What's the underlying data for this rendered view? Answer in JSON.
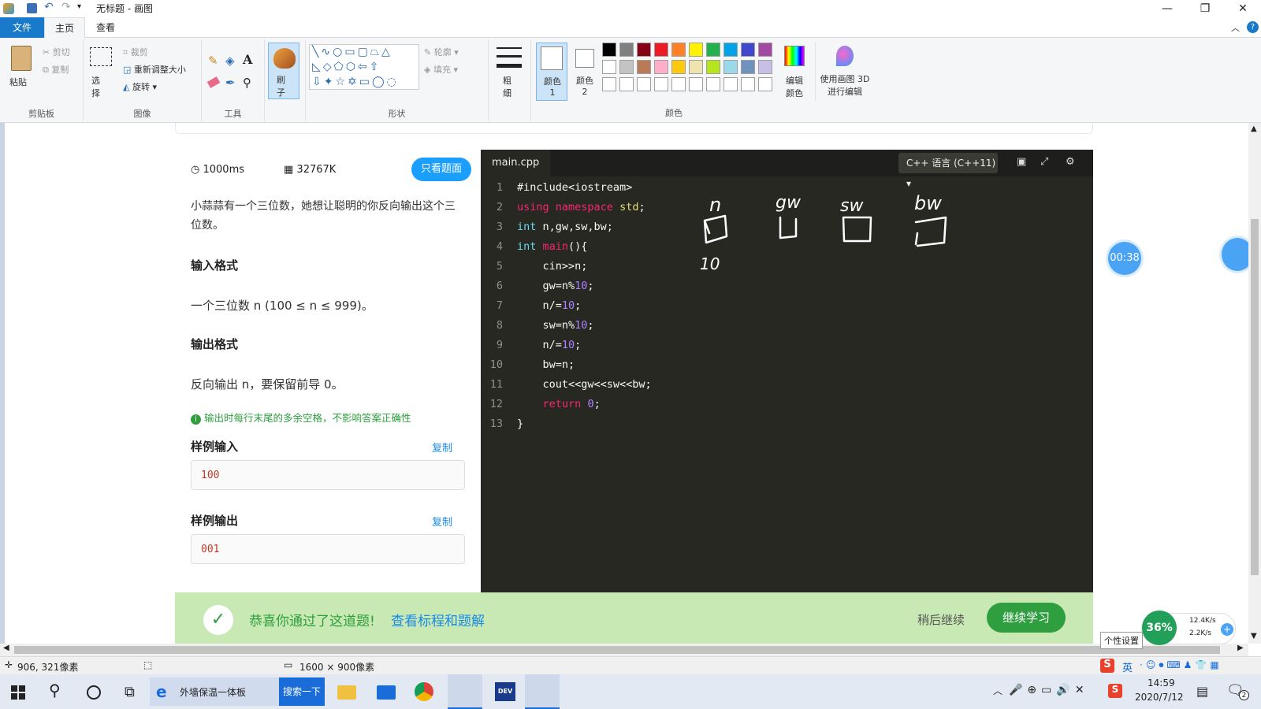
{
  "window": {
    "title": "无标题 - 画图",
    "minimize": "—",
    "maximize": "❐",
    "close": "✕"
  },
  "menu": {
    "file": "文件",
    "home": "主页",
    "view": "查看"
  },
  "ribbon": {
    "clipboard": {
      "paste": "粘贴",
      "cut": "剪切",
      "copy": "复制",
      "label": "剪贴板"
    },
    "image": {
      "select": "选择",
      "crop": "裁剪",
      "resize": "重新调整大小",
      "rotate": "旋转",
      "label": "图像"
    },
    "tools": {
      "label": "工具"
    },
    "brush": {
      "label": "刷子"
    },
    "shapes": {
      "outline": "轮廓",
      "fill": "填充",
      "label": "形状"
    },
    "size": {
      "label": "粗细"
    },
    "color1": "颜色 1",
    "color2": "颜色 2",
    "colors_label": "颜色",
    "edit_colors": "编辑颜色",
    "paint3d": "使用画图 3D 进行编辑",
    "palette_row1": [
      "#000000",
      "#7f7f7f",
      "#880015",
      "#ed1c24",
      "#ff7f27",
      "#fff200",
      "#22b14c",
      "#00a2e8",
      "#3f48cc",
      "#a349a4"
    ],
    "palette_row2": [
      "#ffffff",
      "#c3c3c3",
      "#b97a57",
      "#ffaec9",
      "#ffc90e",
      "#efe4b0",
      "#b5e61d",
      "#99d9ea",
      "#7092be",
      "#c8bfe7"
    ]
  },
  "problem": {
    "time_limit": "1000ms",
    "memory_limit": "32767K",
    "only_problem_btn": "只看题面",
    "description": "小蒜蒜有一个三位数，她想让聪明的你反向输出这个三位数。",
    "input_heading": "输入格式",
    "input_text": "一个三位数 n (100 ≤ n ≤ 999)。",
    "output_heading": "输出格式",
    "output_text": "反向输出 n，要保留前导 0。",
    "note": "输出时每行末尾的多余空格，不影响答案正确性",
    "sample_in_heading": "样例输入",
    "sample_in_copy": "复制",
    "sample_in": "100",
    "sample_out_heading": "样例输出",
    "sample_out_copy": "复制",
    "sample_out": "001"
  },
  "editor": {
    "filename": "main.cpp",
    "language": "C++ 语言 (C++11)",
    "lines": [
      "#include<iostream>",
      "using namespace std;",
      "int n,gw,sw,bw;",
      "int main(){",
      "    cin>>n;",
      "    gw=n%10;",
      "    n/=10;",
      "    sw=n%10;",
      "    n/=10;",
      "    bw=n;",
      "    cout<<gw<<sw<<bw;",
      "    return 0;",
      "}"
    ],
    "sketch_labels": [
      "n",
      "gw",
      "sw",
      "bw",
      "10"
    ]
  },
  "timer": "00:38",
  "success": {
    "message": "恭喜你通过了这道题!",
    "link": "查看标程和题解",
    "later": "稍后继续",
    "continue": "继续学习"
  },
  "netmonitor": {
    "percent": "36%",
    "up": "12.4K/s",
    "down": "2.2K/s",
    "tooltip": "个性设置"
  },
  "status": {
    "cursor": "906, 321像素",
    "size": "1600 × 900像素"
  },
  "taskbar": {
    "ie_title": "外墙保温一体板",
    "search_btn": "搜索一下",
    "time": "14:59",
    "date": "2020/7/12",
    "ime": "英",
    "notif_count": "2"
  }
}
